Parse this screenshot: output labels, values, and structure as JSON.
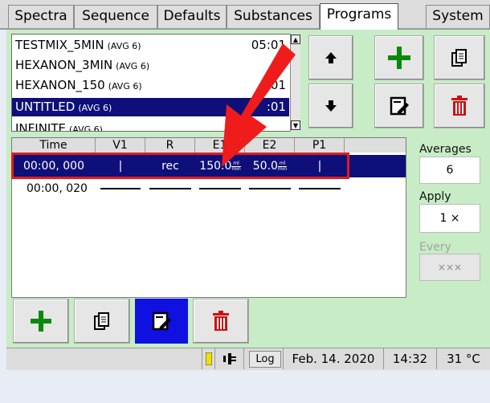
{
  "tabs": [
    "Spectra",
    "Sequence",
    "Defaults",
    "Substances",
    "Programs",
    "System"
  ],
  "active_tab": "Programs",
  "programs": [
    {
      "name": "TESTMIX_5MIN",
      "avg": "(AVG 6)",
      "time": "05:01"
    },
    {
      "name": "HEXANON_3MIN",
      "avg": "(AVG 6)",
      "time": ""
    },
    {
      "name": "HEXANON_150",
      "avg": "(AVG 6)",
      "time": "01"
    },
    {
      "name": "UNTITLED",
      "avg": "(AVG 6)",
      "time": ":01"
    },
    {
      "name": "INFINITE",
      "avg": "(AVG 6)",
      "time": ""
    }
  ],
  "table": {
    "headers": [
      "Time",
      "V1",
      "R",
      "E1",
      "E2",
      "P1"
    ],
    "row1": {
      "time": "00:00, 000",
      "v1": "|",
      "r": "rec",
      "e1": "150.0",
      "e2": "50.0",
      "p1": "|",
      "unit_top": "ml",
      "unit_bottom": "min"
    },
    "row2": {
      "time": "00:00, 020"
    }
  },
  "side": {
    "averages_label": "Averages",
    "averages_value": "6",
    "apply_label": "Apply",
    "apply_value": "1 ×",
    "every_label": "Every",
    "every_value": "×××"
  },
  "status": {
    "log": "Log",
    "date": "Feb. 14. 2020",
    "time": "14:32",
    "temp": "31 °C"
  },
  "colors": {
    "selection": "#0f0f7a",
    "panel_green": "#c8ecc6",
    "highlight_red": "#e01b1b",
    "add_green": "#0a8a0a",
    "delete_red": "#d01010"
  }
}
